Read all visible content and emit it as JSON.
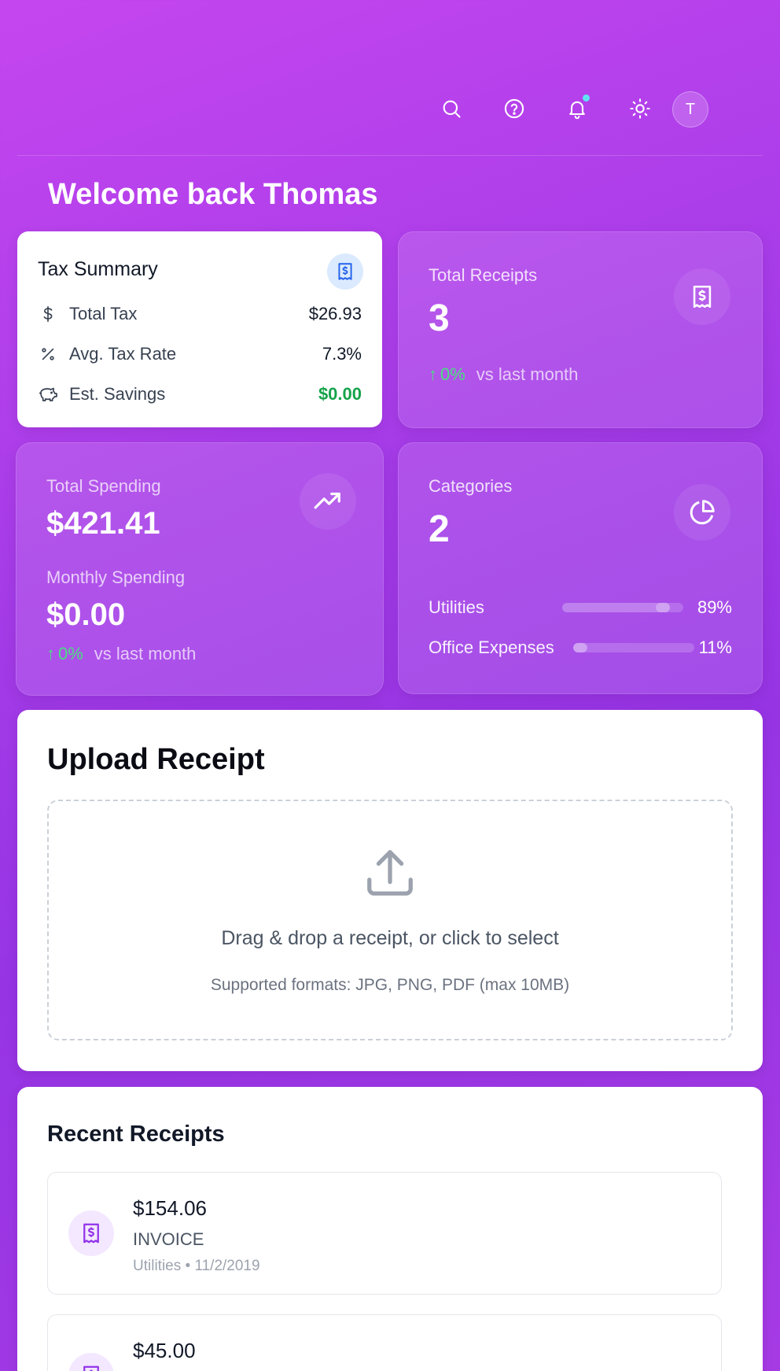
{
  "header": {
    "icons": [
      "search-icon",
      "help-icon",
      "bell-icon",
      "sun-icon"
    ],
    "has_notification": true,
    "avatar_initial": "T"
  },
  "welcome": "Welcome back Thomas",
  "tax_summary": {
    "title": "Tax Summary",
    "rows": [
      {
        "icon": "dollar-icon",
        "label": "Total Tax",
        "value": "$26.93"
      },
      {
        "icon": "percent-icon",
        "label": "Avg. Tax Rate",
        "value": "7.3%"
      },
      {
        "icon": "piggy-bank-icon",
        "label": "Est. Savings",
        "value": "$0.00"
      }
    ]
  },
  "total_receipts": {
    "label": "Total Receipts",
    "value": "3",
    "trend_arrow": "↑",
    "trend": "0%",
    "trend_suffix": "vs last month"
  },
  "spending": {
    "total_label": "Total Spending",
    "total_value": "$421.41",
    "monthly_label": "Monthly Spending",
    "monthly_value": "$0.00",
    "trend_arrow": "↑",
    "trend": "0%",
    "trend_suffix": "vs last month"
  },
  "categories": {
    "label": "Categories",
    "value": "2",
    "items": [
      {
        "name": "Utilities",
        "percent": "89%",
        "fraction": 0.89
      },
      {
        "name": "Office Expenses",
        "percent": "11%",
        "fraction": 0.11
      }
    ]
  },
  "upload": {
    "title": "Upload Receipt",
    "drop_text": "Drag & drop a receipt, or click to select",
    "formats": "Supported formats: JPG, PNG, PDF (max 10MB)"
  },
  "recent": {
    "title": "Recent Receipts",
    "items": [
      {
        "amount": "$154.06",
        "type": "INVOICE",
        "category": "Utilities",
        "date": "11/2/2019"
      },
      {
        "amount": "$45.00"
      }
    ]
  },
  "colors": {
    "accent_purple": "#9333ea",
    "trend_green": "#4ade80",
    "savings_green": "#16a34a",
    "notif_dot": "#5fe3f2"
  }
}
